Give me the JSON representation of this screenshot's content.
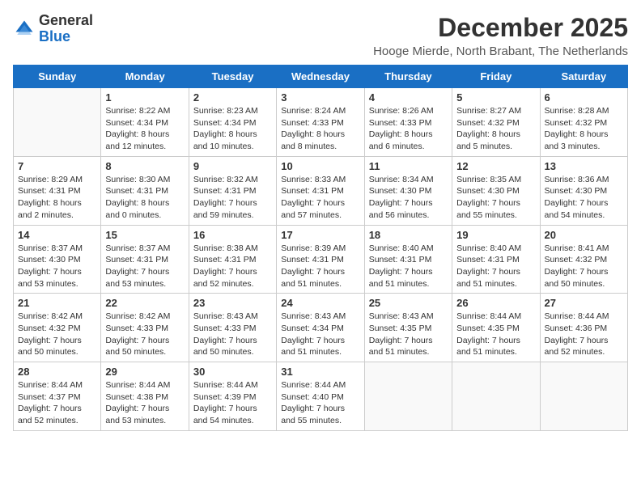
{
  "header": {
    "logo_general": "General",
    "logo_blue": "Blue",
    "month_year": "December 2025",
    "location": "Hooge Mierde, North Brabant, The Netherlands"
  },
  "weekdays": [
    "Sunday",
    "Monday",
    "Tuesday",
    "Wednesday",
    "Thursday",
    "Friday",
    "Saturday"
  ],
  "weeks": [
    [
      {
        "day": "",
        "info": ""
      },
      {
        "day": "1",
        "info": "Sunrise: 8:22 AM\nSunset: 4:34 PM\nDaylight: 8 hours\nand 12 minutes."
      },
      {
        "day": "2",
        "info": "Sunrise: 8:23 AM\nSunset: 4:34 PM\nDaylight: 8 hours\nand 10 minutes."
      },
      {
        "day": "3",
        "info": "Sunrise: 8:24 AM\nSunset: 4:33 PM\nDaylight: 8 hours\nand 8 minutes."
      },
      {
        "day": "4",
        "info": "Sunrise: 8:26 AM\nSunset: 4:33 PM\nDaylight: 8 hours\nand 6 minutes."
      },
      {
        "day": "5",
        "info": "Sunrise: 8:27 AM\nSunset: 4:32 PM\nDaylight: 8 hours\nand 5 minutes."
      },
      {
        "day": "6",
        "info": "Sunrise: 8:28 AM\nSunset: 4:32 PM\nDaylight: 8 hours\nand 3 minutes."
      }
    ],
    [
      {
        "day": "7",
        "info": "Sunrise: 8:29 AM\nSunset: 4:31 PM\nDaylight: 8 hours\nand 2 minutes."
      },
      {
        "day": "8",
        "info": "Sunrise: 8:30 AM\nSunset: 4:31 PM\nDaylight: 8 hours\nand 0 minutes."
      },
      {
        "day": "9",
        "info": "Sunrise: 8:32 AM\nSunset: 4:31 PM\nDaylight: 7 hours\nand 59 minutes."
      },
      {
        "day": "10",
        "info": "Sunrise: 8:33 AM\nSunset: 4:31 PM\nDaylight: 7 hours\nand 57 minutes."
      },
      {
        "day": "11",
        "info": "Sunrise: 8:34 AM\nSunset: 4:30 PM\nDaylight: 7 hours\nand 56 minutes."
      },
      {
        "day": "12",
        "info": "Sunrise: 8:35 AM\nSunset: 4:30 PM\nDaylight: 7 hours\nand 55 minutes."
      },
      {
        "day": "13",
        "info": "Sunrise: 8:36 AM\nSunset: 4:30 PM\nDaylight: 7 hours\nand 54 minutes."
      }
    ],
    [
      {
        "day": "14",
        "info": "Sunrise: 8:37 AM\nSunset: 4:30 PM\nDaylight: 7 hours\nand 53 minutes."
      },
      {
        "day": "15",
        "info": "Sunrise: 8:37 AM\nSunset: 4:31 PM\nDaylight: 7 hours\nand 53 minutes."
      },
      {
        "day": "16",
        "info": "Sunrise: 8:38 AM\nSunset: 4:31 PM\nDaylight: 7 hours\nand 52 minutes."
      },
      {
        "day": "17",
        "info": "Sunrise: 8:39 AM\nSunset: 4:31 PM\nDaylight: 7 hours\nand 51 minutes."
      },
      {
        "day": "18",
        "info": "Sunrise: 8:40 AM\nSunset: 4:31 PM\nDaylight: 7 hours\nand 51 minutes."
      },
      {
        "day": "19",
        "info": "Sunrise: 8:40 AM\nSunset: 4:31 PM\nDaylight: 7 hours\nand 51 minutes."
      },
      {
        "day": "20",
        "info": "Sunrise: 8:41 AM\nSunset: 4:32 PM\nDaylight: 7 hours\nand 50 minutes."
      }
    ],
    [
      {
        "day": "21",
        "info": "Sunrise: 8:42 AM\nSunset: 4:32 PM\nDaylight: 7 hours\nand 50 minutes."
      },
      {
        "day": "22",
        "info": "Sunrise: 8:42 AM\nSunset: 4:33 PM\nDaylight: 7 hours\nand 50 minutes."
      },
      {
        "day": "23",
        "info": "Sunrise: 8:43 AM\nSunset: 4:33 PM\nDaylight: 7 hours\nand 50 minutes."
      },
      {
        "day": "24",
        "info": "Sunrise: 8:43 AM\nSunset: 4:34 PM\nDaylight: 7 hours\nand 51 minutes."
      },
      {
        "day": "25",
        "info": "Sunrise: 8:43 AM\nSunset: 4:35 PM\nDaylight: 7 hours\nand 51 minutes."
      },
      {
        "day": "26",
        "info": "Sunrise: 8:44 AM\nSunset: 4:35 PM\nDaylight: 7 hours\nand 51 minutes."
      },
      {
        "day": "27",
        "info": "Sunrise: 8:44 AM\nSunset: 4:36 PM\nDaylight: 7 hours\nand 52 minutes."
      }
    ],
    [
      {
        "day": "28",
        "info": "Sunrise: 8:44 AM\nSunset: 4:37 PM\nDaylight: 7 hours\nand 52 minutes."
      },
      {
        "day": "29",
        "info": "Sunrise: 8:44 AM\nSunset: 4:38 PM\nDaylight: 7 hours\nand 53 minutes."
      },
      {
        "day": "30",
        "info": "Sunrise: 8:44 AM\nSunset: 4:39 PM\nDaylight: 7 hours\nand 54 minutes."
      },
      {
        "day": "31",
        "info": "Sunrise: 8:44 AM\nSunset: 4:40 PM\nDaylight: 7 hours\nand 55 minutes."
      },
      {
        "day": "",
        "info": ""
      },
      {
        "day": "",
        "info": ""
      },
      {
        "day": "",
        "info": ""
      }
    ]
  ]
}
